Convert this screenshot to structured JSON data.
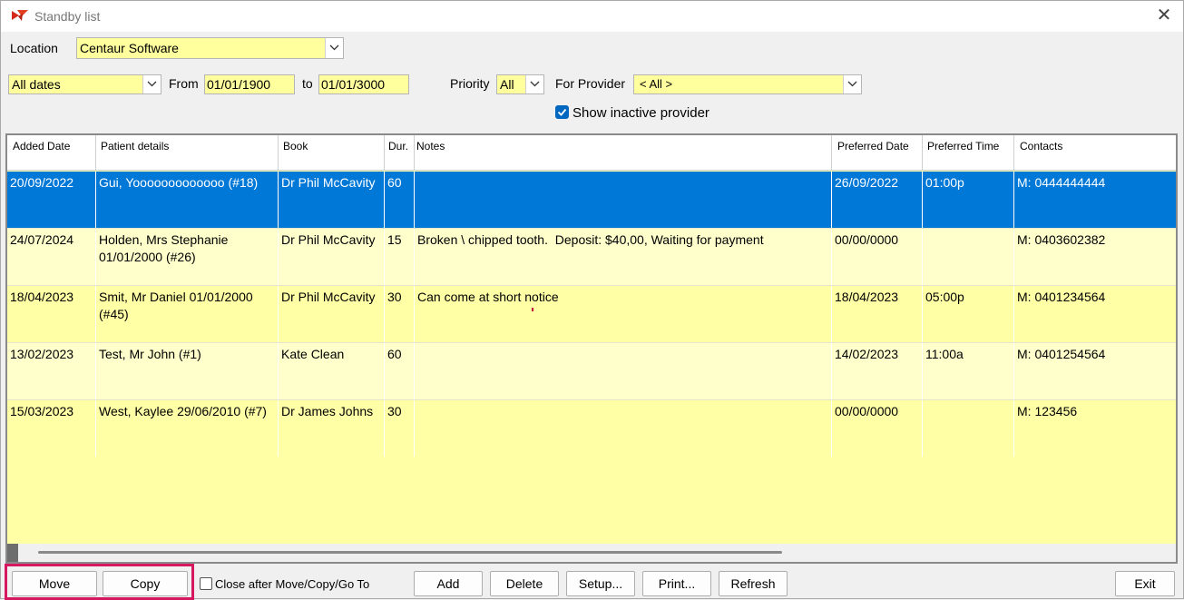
{
  "window": {
    "title": "Standby list",
    "close": "✕"
  },
  "filters": {
    "location_label": "Location",
    "location_value": "Centaur Software",
    "dates_value": "All dates",
    "from_label": "From",
    "from_value": "01/01/1900",
    "to_label": "to",
    "to_value": "01/01/3000",
    "priority_label": "Priority",
    "priority_value": "All",
    "provider_label": "For Provider",
    "provider_value": "< All >",
    "show_inactive_label": "Show inactive provider",
    "show_inactive_checked": true
  },
  "table": {
    "columns": [
      "Added Date",
      "Patient details",
      "Book",
      "Dur.",
      "Notes",
      "Preferred Date",
      "Preferred Time",
      "Contacts"
    ],
    "rows": [
      {
        "added": "20/09/2022",
        "patient": "Gui, Yooooooooooooo (#18)",
        "book": "Dr Phil McCavity",
        "dur": "60",
        "notes": "",
        "pref_date": "26/09/2022",
        "pref_time": "01:00p",
        "contacts": "M: 0444444444"
      },
      {
        "added": "24/07/2024",
        "patient": "Holden, Mrs Stephanie 01/01/2000 (#26)",
        "book": "Dr Phil McCavity",
        "dur": "15",
        "notes": "Broken \\ chipped tooth.  Deposit: $40,00, Waiting for payment",
        "pref_date": "00/00/0000",
        "pref_time": "",
        "contacts": "M: 0403602382"
      },
      {
        "added": "18/04/2023",
        "patient": "Smit, Mr Daniel 01/01/2000 (#45)",
        "book": "Dr Phil McCavity",
        "dur": "30",
        "notes": "Can come at short notice",
        "pref_date": "18/04/2023",
        "pref_time": "05:00p",
        "contacts": "M: 0401234564"
      },
      {
        "added": "13/02/2023",
        "patient": "Test, Mr John (#1)",
        "book": "Kate Clean",
        "dur": "60",
        "notes": "",
        "pref_date": "14/02/2023",
        "pref_time": "11:00a",
        "contacts": "M: 0401254564"
      },
      {
        "added": "15/03/2023",
        "patient": "West, Kaylee 29/06/2010 (#7)",
        "book": "Dr James Johns",
        "dur": "30",
        "notes": "",
        "pref_date": "00/00/0000",
        "pref_time": "",
        "contacts": "M: 123456"
      }
    ]
  },
  "footer": {
    "move": "Move",
    "copy": "Copy",
    "close_after_label": "Close after Move/Copy/Go To",
    "add": "Add",
    "delete": "Delete",
    "setup": "Setup...",
    "print": "Print...",
    "refresh": "Refresh",
    "exit": "Exit"
  },
  "colors": {
    "field_bg": "#ffff9e",
    "selected_row": "#0078d7",
    "highlight_box": "#d6185f"
  }
}
